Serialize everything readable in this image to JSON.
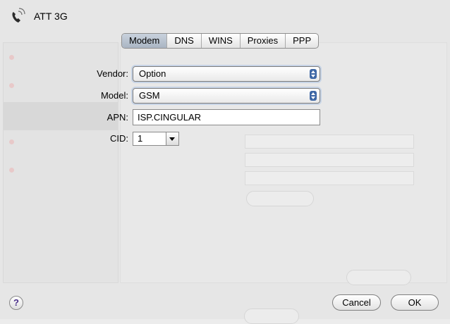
{
  "window": {
    "title": "ATT 3G"
  },
  "tabs": [
    {
      "label": "Modem",
      "active": true
    },
    {
      "label": "DNS",
      "active": false
    },
    {
      "label": "WINS",
      "active": false
    },
    {
      "label": "Proxies",
      "active": false
    },
    {
      "label": "PPP",
      "active": false
    }
  ],
  "form": {
    "vendor_label": "Vendor:",
    "vendor_value": "Option",
    "model_label": "Model:",
    "model_value": "GSM",
    "apn_label": "APN:",
    "apn_value": "ISP.CINGULAR",
    "cid_label": "CID:",
    "cid_value": "1"
  },
  "buttons": {
    "help": "?",
    "cancel": "Cancel",
    "ok": "OK"
  },
  "colors": {
    "popup_arrows": "#3e67a5",
    "active_tab": "#b4bfcc",
    "help_glyph": "#4a2f8a"
  }
}
